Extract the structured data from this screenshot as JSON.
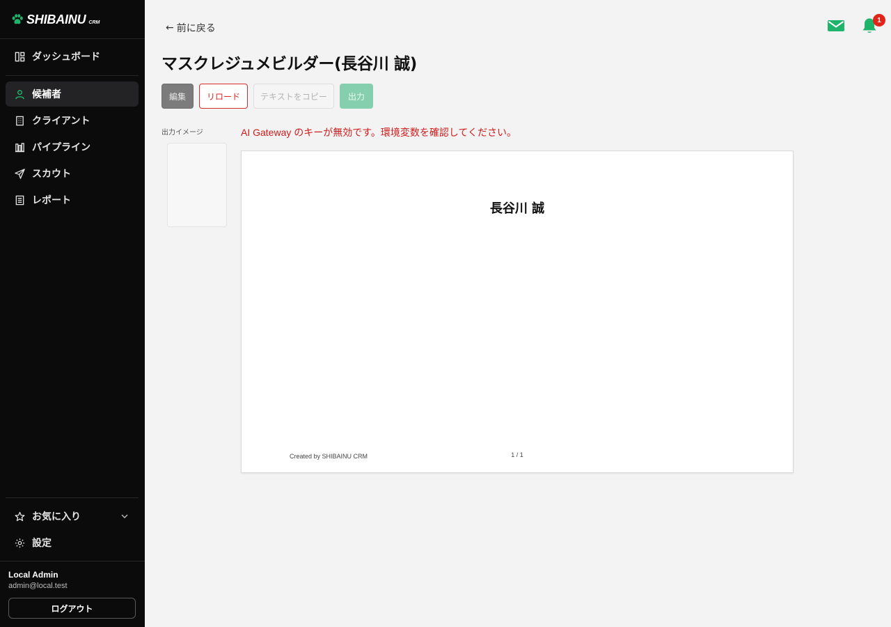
{
  "brand": {
    "name": "SHIBAINU",
    "suffix": "CRM",
    "accent": "#1fb36b"
  },
  "sidebar": {
    "items": [
      {
        "label": "ダッシュボード",
        "icon": "dashboard-icon"
      },
      {
        "label": "候補者",
        "icon": "person-icon",
        "active": true
      },
      {
        "label": "クライアント",
        "icon": "building-icon"
      },
      {
        "label": "パイプライン",
        "icon": "pipeline-icon"
      },
      {
        "label": "スカウト",
        "icon": "send-icon"
      },
      {
        "label": "レポート",
        "icon": "report-icon"
      }
    ],
    "bottom_items": [
      {
        "label": "お気に入り",
        "icon": "star-icon",
        "expand_icon": "chevron-down-icon"
      },
      {
        "label": "設定",
        "icon": "gear-icon"
      }
    ],
    "user": {
      "name": "Local Admin",
      "email": "admin@local.test"
    },
    "logout_label": "ログアウト"
  },
  "header": {
    "back_label": "前に戻る",
    "back_arrow": "←",
    "notification_count": "1"
  },
  "page": {
    "title": "マスクレジュメビルダー(長谷川 誠)"
  },
  "toolbar": {
    "edit_label": "編集",
    "reload_label": "リロード",
    "copy_label": "テキストをコピー",
    "output_label": "出力"
  },
  "output_panel": {
    "thumbnail_label": "出力イメージ"
  },
  "error": {
    "message": "AI Gateway のキーが無効です。環境変数を確認してください。"
  },
  "preview": {
    "candidate_name": "長谷川 誠",
    "footer_credit": "Created by SHIBAINU CRM",
    "page_indicator": "1 / 1"
  }
}
